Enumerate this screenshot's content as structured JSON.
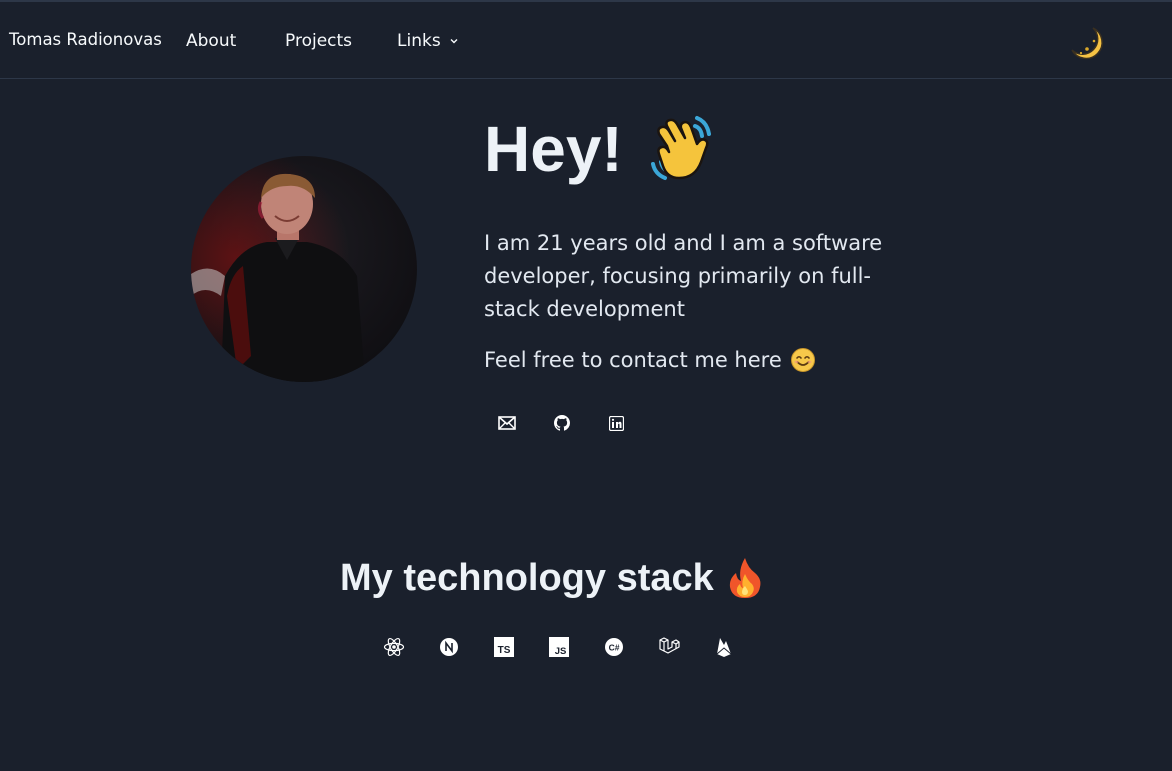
{
  "nav": {
    "brand": "Tomas Radionovas",
    "about": "About",
    "projects": "Projects",
    "links": "Links"
  },
  "hero": {
    "title": "Hey!",
    "intro": "I am 21 years old and I am a software developer, focusing primarily on full-stack development",
    "contact": "Feel free to contact me here"
  },
  "stack": {
    "title": "My technology stack",
    "items": [
      "React",
      "Next.js",
      "TypeScript",
      "JavaScript",
      "C#",
      "Laravel",
      "Firebase"
    ]
  },
  "icons": {
    "theme_toggle": "moon-icon",
    "socials": [
      "email-icon",
      "github-icon",
      "linkedin-icon"
    ]
  },
  "colors": {
    "background": "#1a202c",
    "text": "#e2e8f0",
    "border": "#2d3748"
  }
}
